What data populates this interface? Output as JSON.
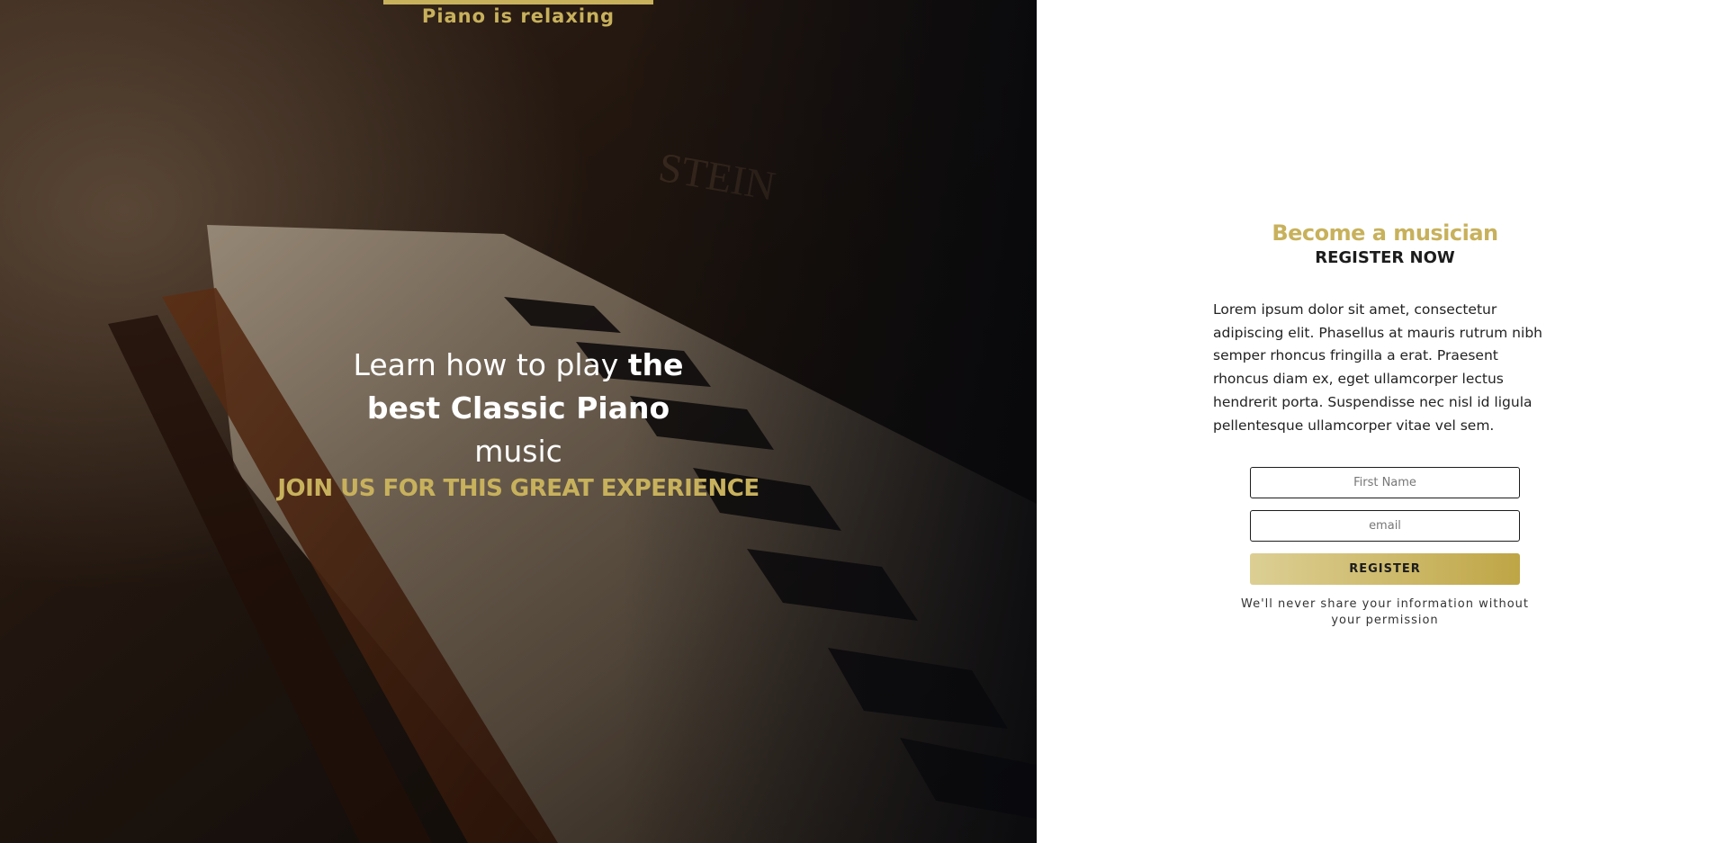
{
  "hero": {
    "tagline": "Piano is relaxing",
    "headline": {
      "line1_normal": "Learn how to play ",
      "line1_bold": "the",
      "line2_bold": "best Classic Piano",
      "line3_normal": "music"
    },
    "cta_text": "JOIN US FOR THIS GREAT EXPERIENCE",
    "image_subject": "blurred close-up of vintage piano keys"
  },
  "panel": {
    "title": "Become a musician",
    "subtitle": "REGISTER NOW",
    "body": "Lorem ipsum dolor sit amet, consectetur adipiscing elit. Phasellus at mauris rutrum nibh semper rhoncus fringilla a erat. Praesent rhoncus diam ex, eget ullamcorper lectus hendrerit porta. Suspendisse nec nisl id ligula pellentesque ullamcorper vitae vel sem.",
    "form": {
      "first_name_placeholder": "First Name",
      "email_placeholder": "email",
      "register_label": "REGISTER",
      "privacy_note": "We'll never share your information without your permission"
    }
  },
  "colors": {
    "accent_gold": "#c8b15c",
    "dark_text": "#1c1c1c",
    "hero_dark": "#1a120c"
  }
}
